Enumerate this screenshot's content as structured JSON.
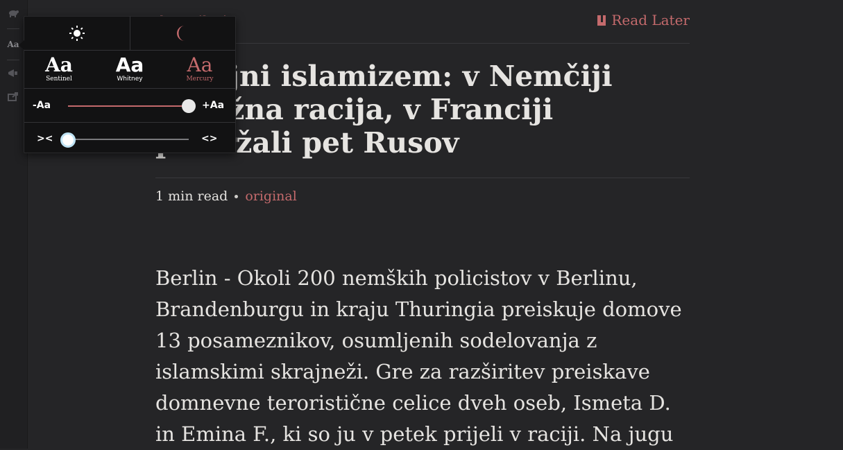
{
  "sidebar": {
    "icons": [
      "turtle-icon",
      "font-settings-icon",
      "megaphone-icon",
      "share-icon"
    ],
    "font_button_label": "Aa"
  },
  "article": {
    "site_name": "dnevnik.si",
    "read_later_label": "Read Later",
    "title": "Skrajni islamizem: v Nemčiji obsežna racija, v Franciji pridržali pet Rusov",
    "read_time": "1 min read",
    "original_link": "original",
    "body": "Berlin -  Okoli 200 nemških policistov v Berlinu, Brandenburgu in kraju Thuringia preiskuje domove 13 posameznikov, osumljenih sodelovanja z islamskimi skrajneži. Gre za razširitev preiskave domnevne teroristične celice dveh oseb, Ismeta D. in Emina F., ki so ju v petek prijeli v raciji. Na jugu"
  },
  "settings_popover": {
    "theme": {
      "light_icon": "sun-icon",
      "dark_icon": "moon-icon",
      "selected": "dark"
    },
    "fonts": [
      {
        "sample": "Aa",
        "name": "Sentinel",
        "selected": false
      },
      {
        "sample": "Aa",
        "name": "Whitney",
        "selected": false
      },
      {
        "sample": "Aa",
        "name": "Mercury",
        "selected": true
      }
    ],
    "font_size": {
      "min_label": "-Aa",
      "max_label": "+Aa",
      "level": 1.0
    },
    "width": {
      "min_label": "><",
      "max_label": "<>",
      "level": 0.0
    }
  },
  "colors": {
    "accent": "#c46a6c",
    "background": "#252527",
    "popover_bg": "#121213",
    "text": "#e4e2df"
  }
}
